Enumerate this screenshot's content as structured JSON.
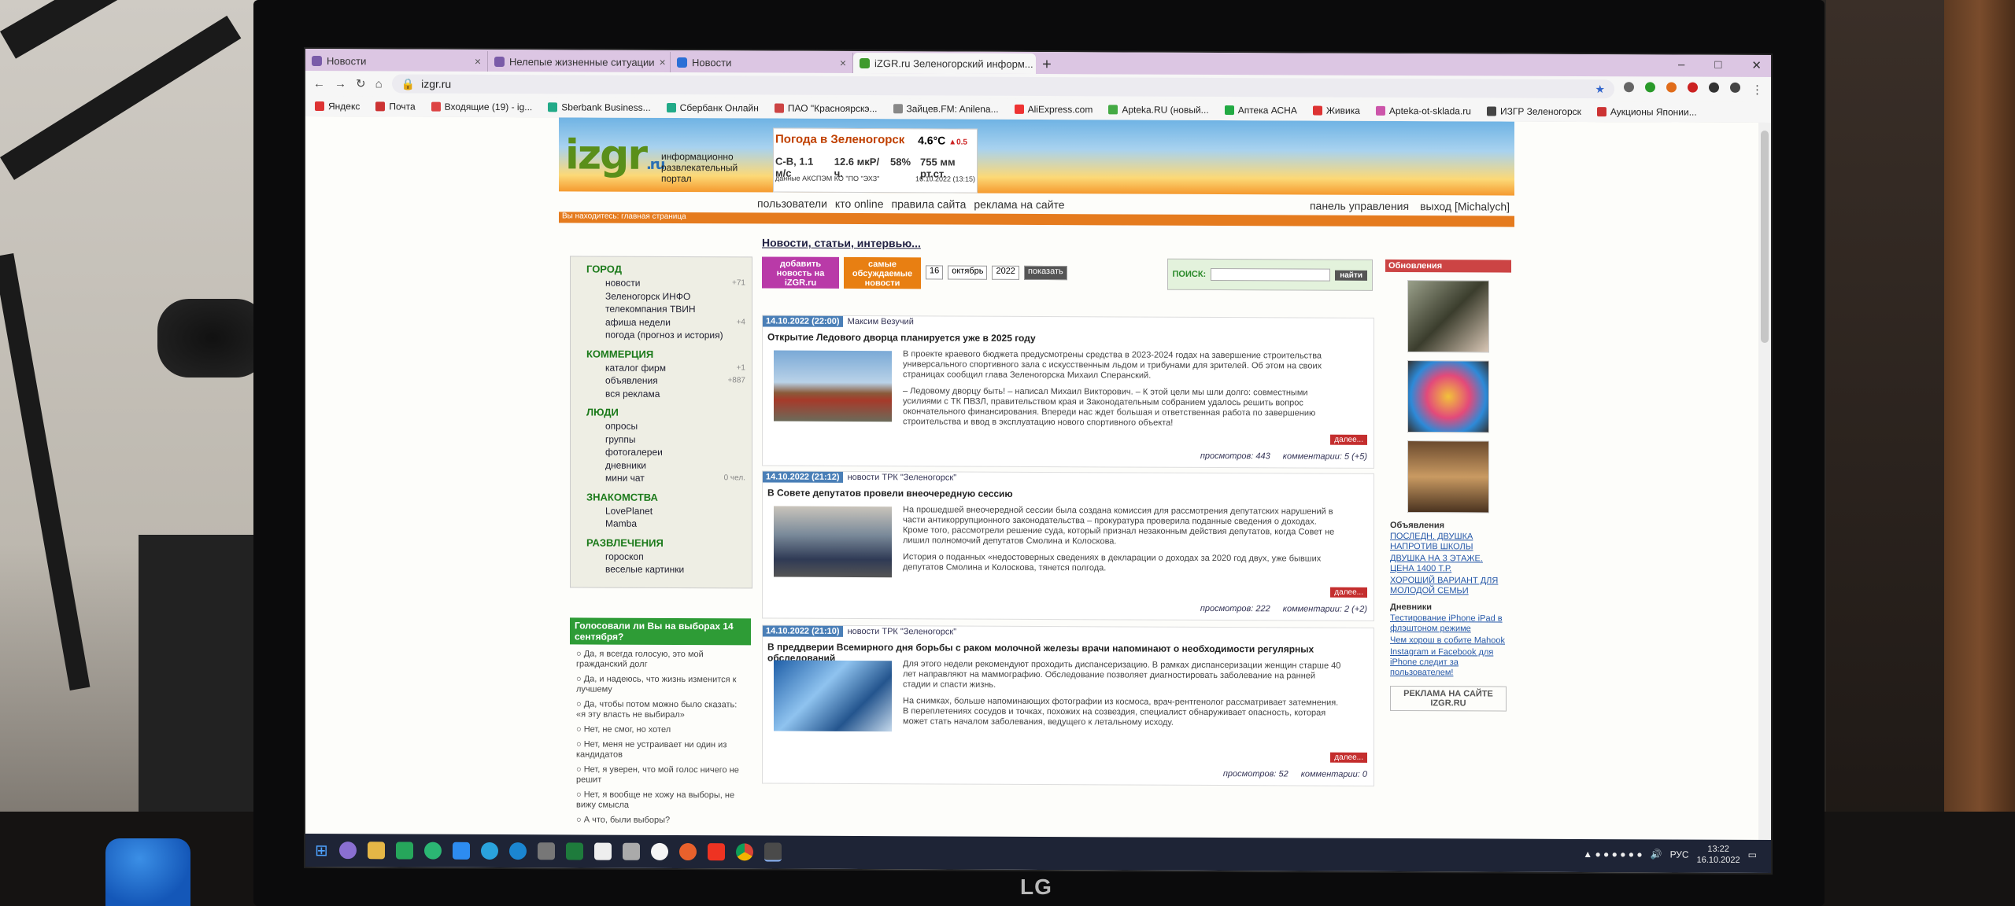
{
  "tabs": [
    {
      "title": "Новости",
      "active": false,
      "color": "#7a5ba8"
    },
    {
      "title": "Нелепые жизненные ситуации",
      "active": false,
      "color": "#7a5ba8"
    },
    {
      "title": "Новости",
      "active": false,
      "color": "#2b6fd6"
    },
    {
      "title": "iZGR.ru Зеленогорский информ...",
      "active": true,
      "color": "#3f9a2d"
    }
  ],
  "window_controls": [
    "–",
    "□",
    "✕"
  ],
  "address": {
    "url": "izgr.ru"
  },
  "bookmarks": [
    "Яндекс",
    "Почта",
    "Входящие (19) - ig...",
    "Sberbank Business...",
    "Сбербанк Онлайн",
    "ПАО \"Красноярскэ...",
    "Зайцев.FM: Anilena...",
    "AliExpress.com",
    "Apteka.RU (новый...",
    "Аптека АСНА",
    "Живика",
    "Apteka-ot-sklada.ru",
    "ИЗГР Зеленогорск",
    "Аукционы Японии..."
  ],
  "header": {
    "logo": "izgr",
    "logo_suffix": ".ru",
    "tagline": [
      "информационно",
      "развлекательный",
      "портал"
    ],
    "weather": {
      "title": "Погода в Зеленогорск",
      "temp": "4.6°C",
      "delta": "▲0.5",
      "wind": "С-В, 1.1 м/с",
      "radiation": "12.6 мкР/ч.",
      "humidity": "58%",
      "pressure": "755 мм рт.ст.",
      "source": "данные АКСПЭМ КО \"ПО \"ЭХЗ\"",
      "datetime": "16.10.2022 (13:15)"
    },
    "nav": [
      "пользователи",
      "кто online",
      "правила сайта",
      "реклама на сайте"
    ],
    "nav_right": [
      "панель управления",
      "выход [Michalych]"
    ],
    "crumb": "Вы находитесь: главная страница"
  },
  "sidebar": [
    {
      "title": "ГОРОД",
      "items": [
        {
          "l": "новости",
          "c": "+71"
        },
        {
          "l": "Зеленогорск ИНФО",
          "c": ""
        },
        {
          "l": "телекомпания ТВИН",
          "c": ""
        },
        {
          "l": "афиша недели",
          "c": "+4"
        },
        {
          "l": "погода (прогноз и история)",
          "c": ""
        }
      ]
    },
    {
      "title": "КОММЕРЦИЯ",
      "items": [
        {
          "l": "каталог фирм",
          "c": "+1"
        },
        {
          "l": "объявления",
          "c": "+887"
        },
        {
          "l": "вся реклама",
          "c": ""
        }
      ]
    },
    {
      "title": "ЛЮДИ",
      "items": [
        {
          "l": "опросы",
          "c": ""
        },
        {
          "l": "группы",
          "c": ""
        },
        {
          "l": "фотогалереи",
          "c": ""
        },
        {
          "l": "дневники",
          "c": ""
        },
        {
          "l": "мини чат",
          "c": "0 чел."
        }
      ]
    },
    {
      "title": "ЗНАКОМСТВА",
      "items": [
        {
          "l": "LovePlanet",
          "c": ""
        },
        {
          "l": "Mamba",
          "c": ""
        }
      ]
    },
    {
      "title": "РАЗВЛЕЧЕНИЯ",
      "items": [
        {
          "l": "гороскоп",
          "c": ""
        },
        {
          "l": "веселые картинки",
          "c": ""
        }
      ]
    }
  ],
  "poll": {
    "question": "Голосовали ли Вы на выборах 14 сентября?",
    "options": [
      "Да, я всегда голосую, это мой гражданский долг",
      "Да, и надеюсь, что жизнь изменится к лучшему",
      "Да, чтобы потом можно было сказать: «я эту власть не выбирал»",
      "Нет, не смог, но хотел",
      "Нет, меня не устраивает ни один из кандидатов",
      "Нет, я уверен, что мой голос ничего не решит",
      "Нет, я вообще не хожу на выборы, не вижу смысла",
      "А что, были выборы?"
    ]
  },
  "center": {
    "title": "Новости, статьи, интервью...",
    "add_btn": "добавить новость на iZGR.ru",
    "popular_btn": "самые обсуждаемые новости",
    "day": "16",
    "month": "октябрь",
    "year": "2022",
    "show": "показать",
    "search_label": "ПОИСК:",
    "search_btn": "найти"
  },
  "articles": [
    {
      "date": "14.10.2022 (22:00)",
      "author": "Максим Везучий",
      "title": "Открытие Ледового дворца планируется уже в 2025 году",
      "text": "В проекте краевого бюджета предусмотрены средства в 2023-2024 годах на завершение строительства универсального спортивного зала с искусственным льдом и трибунами для зрителей. Об этом на своих страницах сообщил глава Зеленогорска Михаил Сперанский.",
      "text2": "– Ледовому дворцу быть! – написал Михаил Викторович. – К этой цели мы шли долго: совместными усилиями с ТК ПВЗЛ, правительством края и Законодательным собранием удалось решить вопрос окончательного финансирования. Впереди нас ждет большая и ответственная работа по завершению строительства и ввод в эксплуатацию нового спортивного объекта!",
      "views": "просмотров: 443",
      "comments": "комментарии: 5 (+5)",
      "more": "далее..."
    },
    {
      "date": "14.10.2022 (21:12)",
      "author": "новости ТРК \"Зеленогорск\"",
      "title": "В Совете депутатов провели внеочередную сессию",
      "text": "На прошедшей внеочередной сессии была создана комиссия для рассмотрения депутатских нарушений в части антикоррупционного законодательства – прокуратура проверила поданные сведения о доходах. Кроме того, рассмотрели решение суда, который признал незаконным действия депутатов, когда Совет не лишил полномочий депутатов Смолина и Колоскова.",
      "text2": "История о поданных «недостоверных сведениях в декларации о доходах за 2020 год двух, уже бывших депутатов Смолина и Колоскова, тянется полгода.",
      "views": "просмотров: 222",
      "comments": "комментарии: 2 (+2)",
      "more": "далее..."
    },
    {
      "date": "14.10.2022 (21:10)",
      "author": "новости ТРК \"Зеленогорск\"",
      "title": "В преддверии Всемирного дня борьбы с раком молочной железы врачи напоминают о необходимости регулярных обследований",
      "text": "Для этого недели рекомендуют проходить диспансеризацию. В рамках диспансеризации женщин старше 40 лет направляют на маммографию. Обследование позволяет диагностировать заболевание на ранней стадии и спасти жизнь.",
      "text2": "На снимках, больше напоминающих фотографии из космоса, врач-рентгенолог рассматривает затемнения. В переплетениях сосудов и точках, похожих на созвездия, специалист обнаруживает опасность, которая может стать началом заболевания, ведущего к летальному исходу.",
      "views": "просмотров: 52",
      "comments": "комментарии: 0",
      "more": "далее..."
    }
  ],
  "right": {
    "title": "Обновления",
    "ads_title": "Объявления",
    "ads": [
      "ПОСЛЕДН. ДВУШКА НАПРОТИВ ШКОЛЫ",
      "ДВУШКА НА 3 ЭТАЖЕ. ЦЕНА 1400 Т.Р.",
      "ХОРОШИЙ ВАРИАНТ ДЛЯ МОЛОДОЙ СЕМЬИ"
    ],
    "diary_title": "Дневники",
    "diaries": [
      "Тестирование iPhone iPad в флэштоном режиме",
      "Чем хорош в собите Mahook",
      "Instagram и Facebook для iPhone следит за пользователем!"
    ],
    "ad_box": "РЕКЛАМА НА САЙТЕ IZGR.RU"
  },
  "tray": {
    "lang": "РУС",
    "time": "13:22",
    "date": "16.10.2022"
  },
  "brand": "LG"
}
